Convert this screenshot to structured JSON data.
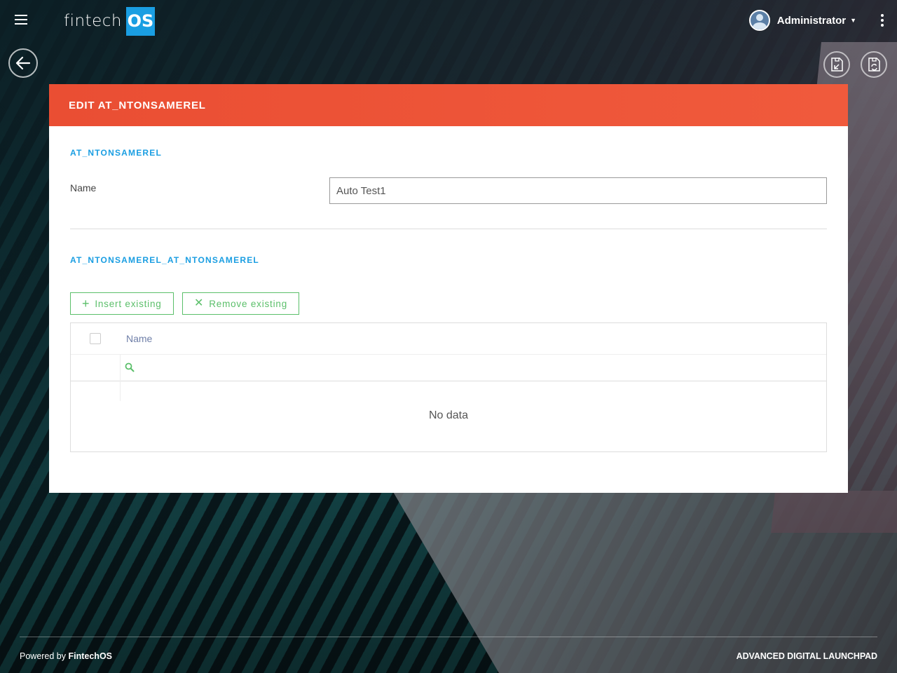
{
  "header": {
    "logo_text": "fintech",
    "logo_badge": "OS",
    "user_name": "Administrator"
  },
  "panel": {
    "title": "EDIT AT_NTONSAMEREL",
    "section1_title": "AT_NTONSAMEREL",
    "name_label": "Name",
    "name_value": "Auto Test1",
    "section2_title": "AT_NTONSAMEREL_AT_NTONSAMEREL",
    "insert_label": "Insert existing",
    "remove_label": "Remove existing",
    "grid": {
      "columns": [
        "Name"
      ],
      "empty_text": "No data"
    }
  },
  "footer": {
    "powered_prefix": "Powered by",
    "powered_brand": "FintechOS",
    "right_text": "ADVANCED DIGITAL LAUNCHPAD"
  },
  "colors": {
    "header_orange": "#ea4e33",
    "accent_blue": "#1a9ee2",
    "action_green": "#5bbf6a"
  }
}
